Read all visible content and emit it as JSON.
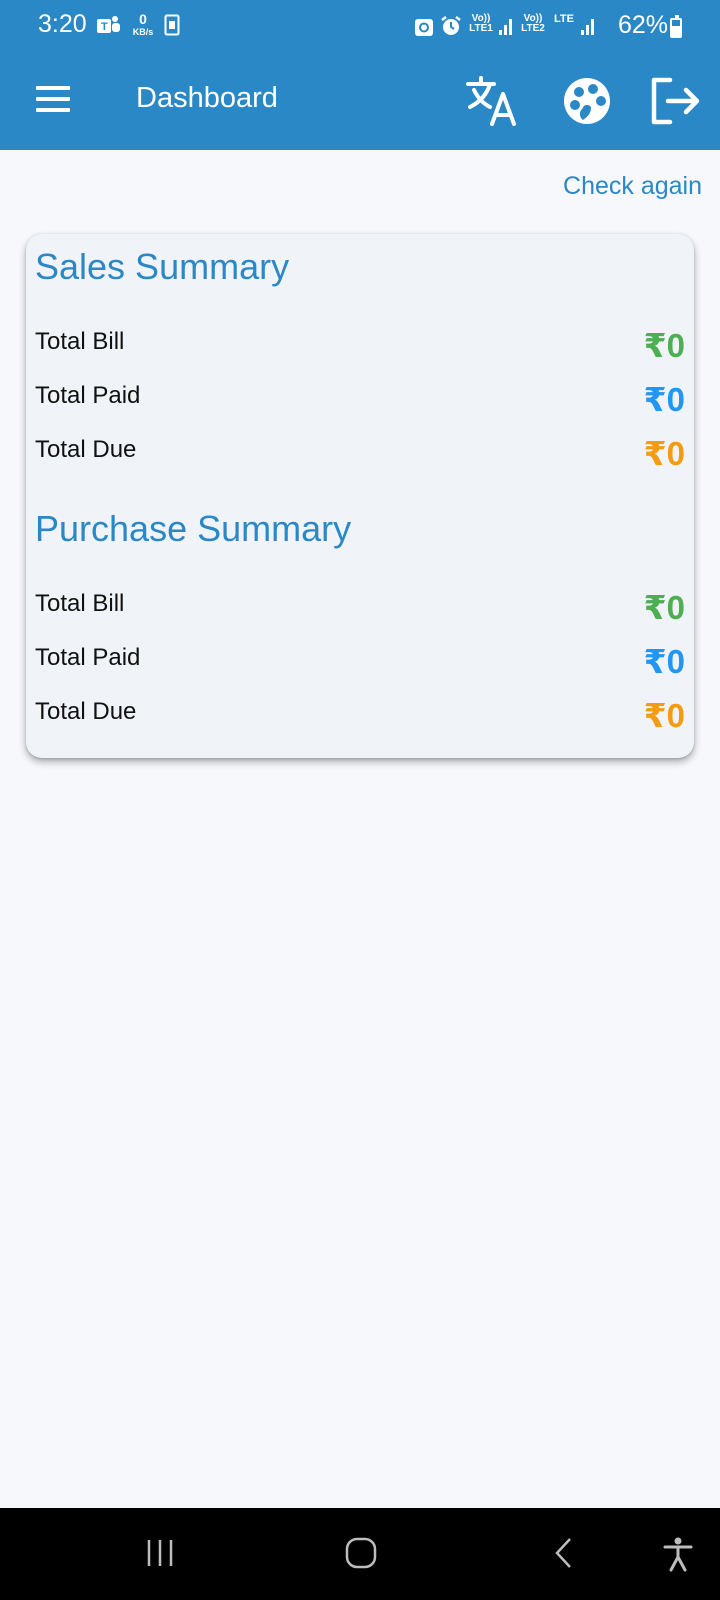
{
  "status_bar": {
    "time": "3:20",
    "data_speed_value": "0",
    "data_speed_unit": "KB/s",
    "sim1_label": "Vo)) LTE1",
    "sim2_label": "Vo)) LTE2",
    "lte_label": "LTE",
    "battery": "62%"
  },
  "app_bar": {
    "title": "Dashboard",
    "icons": [
      "menu-icon",
      "translate-icon",
      "palette-icon",
      "logout-icon"
    ]
  },
  "check_again": "Check again",
  "sales_summary": {
    "title": "Sales Summary",
    "rows": [
      {
        "label": "Total Bill",
        "value": "₹0",
        "color": "#4caf50"
      },
      {
        "label": "Total Paid",
        "value": "₹0",
        "color": "#2196f3"
      },
      {
        "label": "Total Due",
        "value": "₹0",
        "color": "#f39c12"
      }
    ]
  },
  "purchase_summary": {
    "title": "Purchase Summary",
    "rows": [
      {
        "label": "Total Bill",
        "value": "₹0",
        "color": "#4caf50"
      },
      {
        "label": "Total Paid",
        "value": "₹0",
        "color": "#2196f3"
      },
      {
        "label": "Total Due",
        "value": "₹0",
        "color": "#f39c12"
      }
    ]
  },
  "colors": {
    "primary": "#2b88c6",
    "background": "#f6f8fc",
    "card": "#f0f3f8"
  },
  "nav_bar": {
    "icons": [
      "recents-icon",
      "home-icon",
      "back-icon",
      "accessibility-icon"
    ]
  }
}
